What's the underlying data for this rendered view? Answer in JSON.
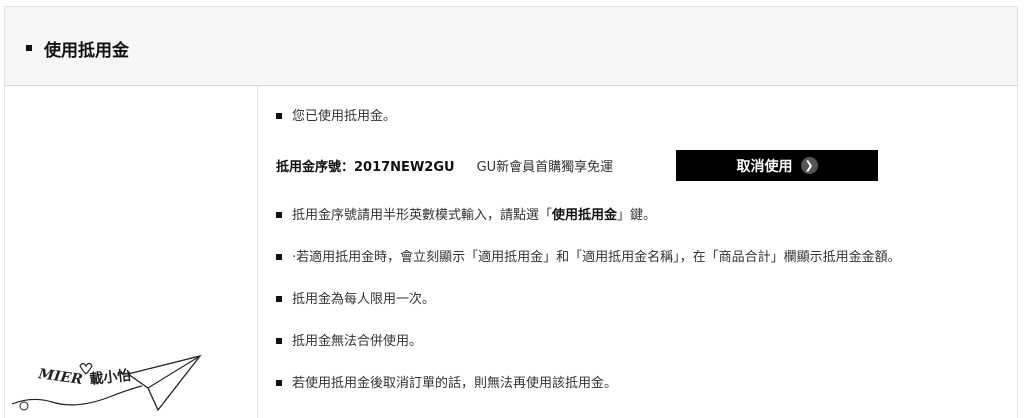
{
  "section": {
    "title": "使用抵用金"
  },
  "notice": {
    "used_message": "您已使用抵用金。"
  },
  "coupon": {
    "code_label": "抵用金序號：2017NEW2GU",
    "description": "GU新會員首購獨享免運"
  },
  "cancel_button": {
    "label": "取消使用",
    "icon": "arrow-right-circle-icon"
  },
  "notes": [
    {
      "prefix": "抵用金序號請用半形英數模式輸入，請點選「",
      "bold": "使用抵用金",
      "suffix": "」鍵。"
    },
    {
      "text": "·若適用抵用金時，會立刻顯示「適用抵用金」和「適用抵用金名稱」，在「商品合計」欄顯示抵用金金額。"
    },
    {
      "text": "抵用金為每人限用一次。"
    },
    {
      "text": "抵用金無法合併使用。"
    },
    {
      "text": "若使用抵用金後取消訂單的話，則無法再使用該抵用金。"
    }
  ],
  "watermark": {
    "text_latin": "MIER",
    "text_cjk": "載小怡"
  },
  "colors": {
    "header_bg": "#f6f6f6",
    "button_bg": "#000000",
    "button_icon_bg": "#555555"
  }
}
